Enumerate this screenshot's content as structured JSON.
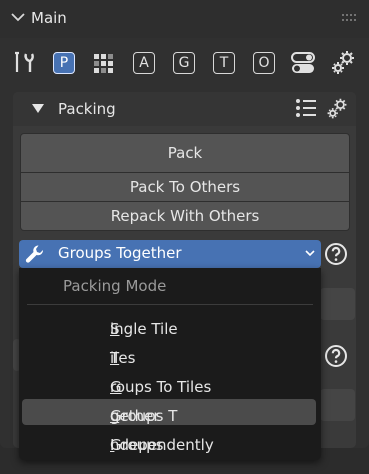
{
  "main": {
    "title": "Main"
  },
  "toolbar": {
    "letters": [
      "P",
      "A",
      "G",
      "T",
      "O"
    ],
    "active": "P"
  },
  "packing": {
    "title": "Packing",
    "pack_label": "Pack",
    "pack_to_others_label": "Pack To Others",
    "repack_label": "Repack With Others"
  },
  "mode_dropdown": {
    "value": "Groups Together"
  },
  "menu": {
    "title": "Packing Mode",
    "items": [
      {
        "pre": "",
        "ul": "S",
        "post": "ingle Tile"
      },
      {
        "pre": "",
        "ul": "T",
        "post": "iles"
      },
      {
        "pre": "",
        "ul": "G",
        "post": "roups To Tiles"
      },
      {
        "pre": "Groups T",
        "ul": "o",
        "post": "gether"
      },
      {
        "pre": "Groups ",
        "ul": "I",
        "post": "ndependently"
      }
    ],
    "highlighted_index": 3
  },
  "colors": {
    "accent": "#4772b3",
    "panel": "#303030",
    "menu": "#1b1b1b"
  }
}
